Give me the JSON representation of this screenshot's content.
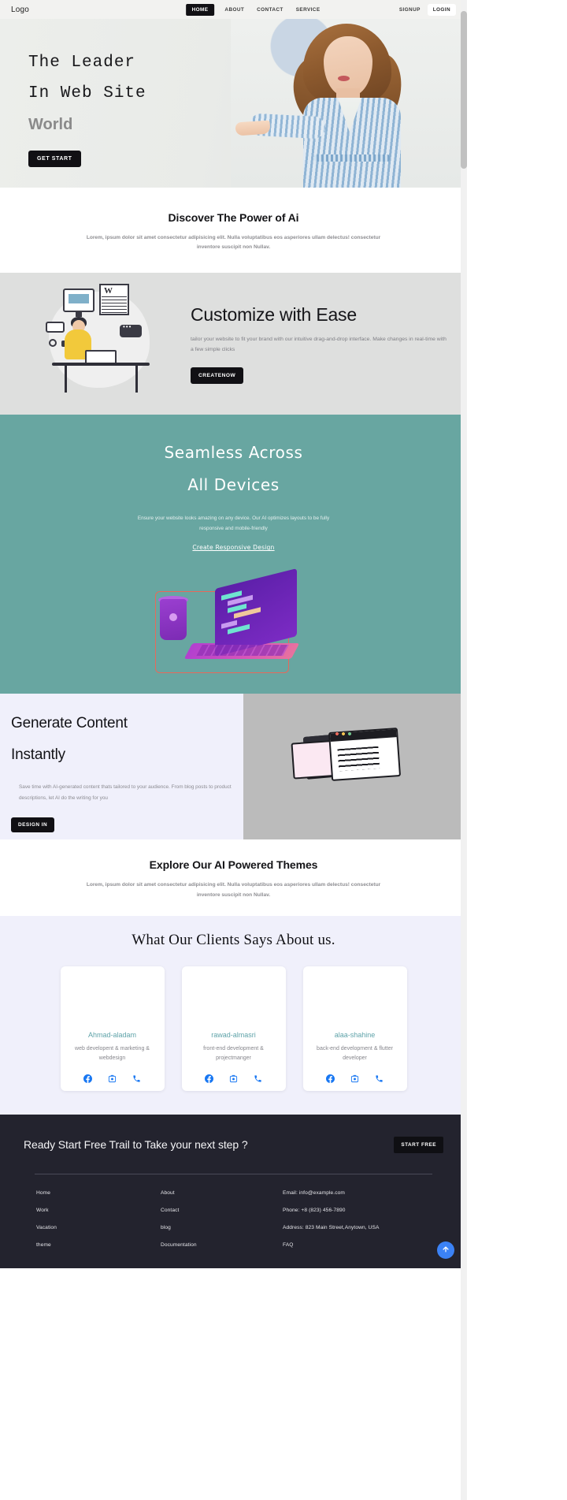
{
  "nav": {
    "logo": "Logo",
    "links": [
      {
        "label": "HOME",
        "active": true
      },
      {
        "label": "ABOUT",
        "active": false
      },
      {
        "label": "CONTACT",
        "active": false
      },
      {
        "label": "SERVICE",
        "active": false
      }
    ],
    "auth": [
      {
        "label": "SIGNUP",
        "boxed": false
      },
      {
        "label": "LOGIN",
        "boxed": true
      }
    ]
  },
  "hero": {
    "line1": "The Leader",
    "line2": "In Web Site",
    "line3": "World",
    "button": "GET START"
  },
  "discover": {
    "heading": "Discover The Power of Ai",
    "paragraph": "Lorem, ipsum dolor sit amet consectetur adipisicing elit. Nulla voluptatibus eos asperiores ullam delectus! consectetur inventore suscipit non Nullav."
  },
  "customize": {
    "heading": "Customize with Ease",
    "paragraph": "tailor your website to fit your brand with our intuitive drag-and-drop interface. Make changes in real-time with a few simple clicks",
    "button": "CREATENOW"
  },
  "devices": {
    "heading_line1": "Seamless Across",
    "heading_line2": "All Devices",
    "paragraph": "Ensure your website looks amazing on any device. Our AI optimizes layouts to be fully responsive and mobile-friendly",
    "link": "Create Responsive Design"
  },
  "generate": {
    "heading_line1": "Generate Content",
    "heading_line2": "Instantly",
    "paragraph": "Save time with AI-generated content thats tailored to your audience. From blog posts to product descriptions, let AI do the writing for you",
    "button": "DESIGN IN"
  },
  "explore": {
    "heading": "Explore Our AI Powered Themes",
    "paragraph": "Lorem, ipsum dolor sit amet consectetur adipisicing elit. Nulla voluptatibus eos asperiores ullam delectus! consectetur inventore suscipit non Nullav."
  },
  "testimonials": {
    "heading": "What Our Clients Says About us.",
    "cards": [
      {
        "name": "Ahmad-aladam",
        "role": "web developent & marketing & webdesign",
        "socials": [
          "facebook-icon",
          "instagram-icon",
          "phone-icon"
        ]
      },
      {
        "name": "rawad-almasri",
        "role": "front-end development & projectmanger",
        "socials": [
          "facebook-icon",
          "instagram-icon",
          "phone-icon"
        ]
      },
      {
        "name": "alaa-shahine",
        "role": "back-end development & flutter developer",
        "socials": [
          "facebook-icon",
          "instagram-icon",
          "phone-icon"
        ]
      }
    ]
  },
  "footer": {
    "cta": "Ready Start Free Trail to Take your next step ?",
    "cta_button": "START FREE",
    "col1": [
      "Home",
      "Work",
      "Vacation",
      "theme"
    ],
    "col2": [
      "About",
      "Contact",
      "blog",
      "Documentation"
    ],
    "col3": [
      "Email: info@example.com",
      "Phone: +8 (823) 456-7890",
      "Address: 823 Main Street,Anytown, USA",
      "FAQ"
    ],
    "scroll_top_icon": "arrow-up-icon"
  },
  "colors": {
    "dark": "#111014",
    "teal": "#68a6a1",
    "lavender": "#f0f0fb",
    "footer_bg": "#23232e",
    "accent_blue": "#3b82f6",
    "name_teal": "#5fa3a9"
  }
}
